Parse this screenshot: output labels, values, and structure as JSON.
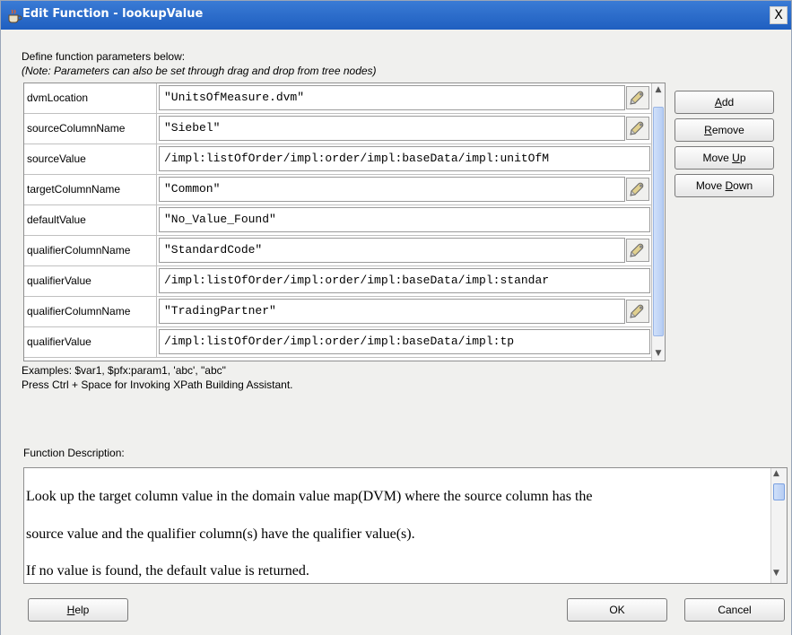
{
  "window": {
    "title": "Edit Function - lookupValue",
    "close_label": "X"
  },
  "instructions": {
    "line1": "Define function parameters below:",
    "line2": "(Note: Parameters can also be set through drag and drop from tree nodes)"
  },
  "parameters": [
    {
      "name": "dvmLocation",
      "value": "\"UnitsOfMeasure.dvm\"",
      "has_picker": true
    },
    {
      "name": "sourceColumnName",
      "value": "\"Siebel\"",
      "has_picker": true
    },
    {
      "name": "sourceValue",
      "value": "/impl:listOfOrder/impl:order/impl:baseData/impl:unitOfM",
      "has_picker": false
    },
    {
      "name": "targetColumnName",
      "value": "\"Common\"",
      "has_picker": true
    },
    {
      "name": "defaultValue",
      "value": "\"No_Value_Found\"",
      "has_picker": false
    },
    {
      "name": "qualifierColumnName",
      "value": "\"StandardCode\"",
      "has_picker": true
    },
    {
      "name": "qualifierValue",
      "value": "/impl:listOfOrder/impl:order/impl:baseData/impl:standar",
      "has_picker": false
    },
    {
      "name": "qualifierColumnName",
      "value": "\"TradingPartner\"",
      "has_picker": true
    },
    {
      "name": "qualifierValue",
      "value": "/impl:listOfOrder/impl:order/impl:baseData/impl:tp",
      "has_picker": false
    }
  ],
  "buttons": {
    "add": "Add",
    "remove": "Remove",
    "move_up": "Move Up",
    "move_down": "Move Down",
    "help": "Help",
    "ok": "OK",
    "cancel": "Cancel"
  },
  "hints": {
    "examples": "Examples: $var1, $pfx:param1, 'abc', \"abc\"",
    "shortcut": "Press Ctrl + Space for Invoking XPath Building Assistant."
  },
  "description": {
    "label": "Function Description:",
    "lines": [
      "Look up the target column value in the domain value map(DVM) where the source column has the",
      "source value and the qualifier column(s) have the qualifier value(s).",
      "If no value is found, the default value is returned."
    ]
  },
  "colors": {
    "titlebar": "#1f5fc0",
    "dialog_bg": "#f0f0ee",
    "scroll_thumb": "#b7cdf3"
  },
  "icons": {
    "title": "coffee-cup-icon",
    "picker": "pencil-picker-icon"
  }
}
